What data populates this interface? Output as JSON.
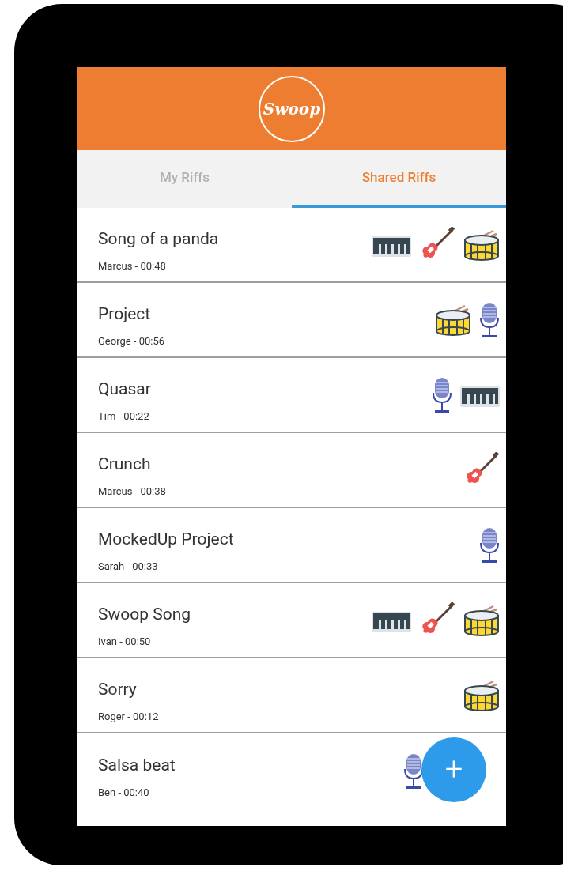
{
  "header": {
    "logo": "Swoop"
  },
  "tabs": [
    {
      "label": "My Riffs",
      "selected": false
    },
    {
      "label": "Shared Riffs",
      "selected": true
    }
  ],
  "riffs": [
    {
      "title": "Song of a panda",
      "subtitle": "Marcus - 00:48",
      "instruments": [
        {
          "kind": "keyboard"
        },
        {
          "kind": "guitar"
        },
        {
          "kind": "drum"
        }
      ]
    },
    {
      "title": "Project",
      "subtitle": "George - 00:56",
      "instruments": [
        {
          "kind": "drum"
        },
        {
          "kind": "mic"
        }
      ]
    },
    {
      "title": "Quasar",
      "subtitle": "Tim - 00:22",
      "instruments": [
        {
          "kind": "mic"
        },
        {
          "kind": "keyboard"
        }
      ]
    },
    {
      "title": "Crunch",
      "subtitle": "Marcus - 00:38",
      "instruments": [
        {
          "kind": "guitar"
        }
      ]
    },
    {
      "title": "MockedUp Project",
      "subtitle": "Sarah - 00:33",
      "instruments": [
        {
          "kind": "mic"
        }
      ]
    },
    {
      "title": "Swoop Song",
      "subtitle": "Ivan - 00:50",
      "instruments": [
        {
          "kind": "keyboard"
        },
        {
          "kind": "guitar"
        },
        {
          "kind": "drum"
        }
      ]
    },
    {
      "title": "Sorry",
      "subtitle": "Roger - 00:12",
      "instruments": [
        {
          "kind": "drum"
        }
      ]
    },
    {
      "title": "Salsa beat",
      "subtitle": "Ben - 00:40",
      "instruments": [
        {
          "kind": "mic"
        }
      ]
    }
  ],
  "fab": {
    "label": "+"
  }
}
